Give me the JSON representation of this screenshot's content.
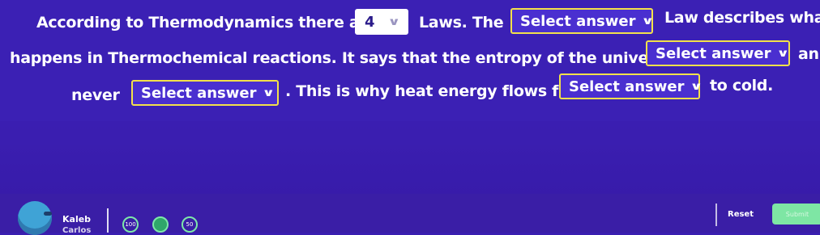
{
  "question": {
    "line1": {
      "text1": "According to Thermodynamics there are",
      "dropdown1_value": "4",
      "text2": "Laws. The",
      "dropdown2_placeholder": "Select answer",
      "text3": "Law describes what"
    },
    "line2": {
      "text1": "happens in Thermochemical reactions. It says that the entropy of the universe always",
      "dropdown3_placeholder": "Select answer",
      "text2": "an"
    },
    "line3": {
      "text1": "never",
      "dropdown4_placeholder": "Select answer",
      "text2": ". This is why heat energy flows from",
      "dropdown5_placeholder": "Select answer",
      "text3": "to cold."
    }
  },
  "footer": {
    "user_name": "Kaleb",
    "user_surname": "Carlos",
    "badges": [
      "100",
      "",
      "50"
    ],
    "reset_label": "Reset",
    "submit_label": "Submit"
  },
  "colors": {
    "background": "#3b20b4",
    "dropdown_border": "#f3e14a",
    "submit_button": "#7ee6a4",
    "avatar": "#3fa3d6"
  },
  "icons": {
    "dropdown": "chevron-down-icon",
    "avatar": "user-avatar-icon"
  }
}
